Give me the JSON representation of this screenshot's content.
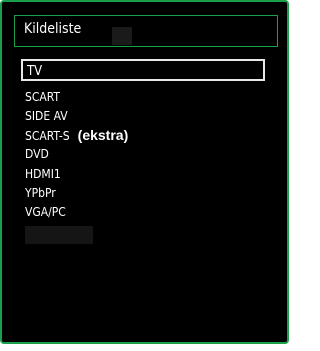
{
  "header": {
    "title": "Kildeliste"
  },
  "sources": [
    {
      "label": "TV",
      "selected": true,
      "extra": ""
    },
    {
      "label": "SCART",
      "selected": false,
      "extra": ""
    },
    {
      "label": "SIDE AV",
      "selected": false,
      "extra": ""
    },
    {
      "label": "SCART-S",
      "selected": false,
      "extra": "(ekstra)"
    },
    {
      "label": "DVD",
      "selected": false,
      "extra": ""
    },
    {
      "label": "HDMI1",
      "selected": false,
      "extra": ""
    },
    {
      "label": "YPbPr",
      "selected": false,
      "extra": ""
    },
    {
      "label": "VGA/PC",
      "selected": false,
      "extra": ""
    }
  ],
  "colors": {
    "background": "#000000",
    "frame": "#1aa04a",
    "selection_border": "#e8e8e8",
    "text": "#ffffff"
  }
}
